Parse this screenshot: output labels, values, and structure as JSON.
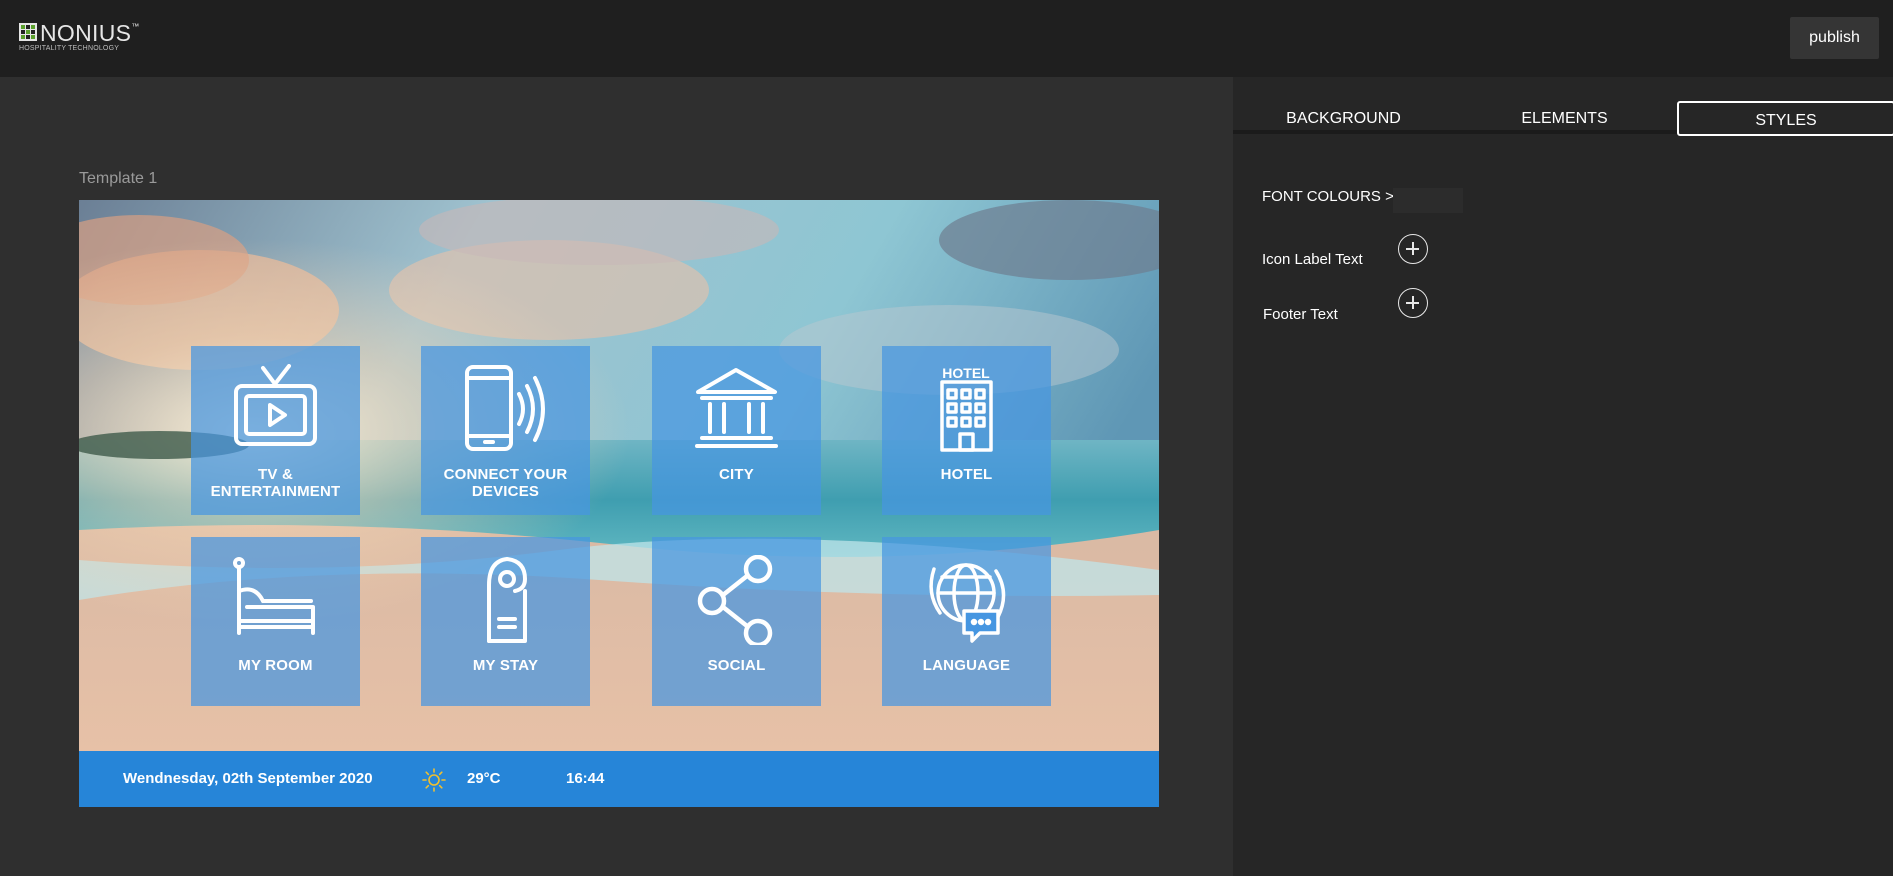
{
  "app": {
    "logo_brand": "NONIUS",
    "logo_tm": "™",
    "logo_tagline": "HOSPITALITY TECHNOLOGY",
    "publish_label": "publish"
  },
  "panel": {
    "tabs": [
      {
        "label": "BACKGROUND"
      },
      {
        "label": "ELEMENTS"
      },
      {
        "label": "STYLES",
        "active": true
      }
    ],
    "section_title": "FONT COLOURS >",
    "rows": [
      {
        "label": "Icon Label Text"
      },
      {
        "label": "Footer Text"
      }
    ]
  },
  "canvas": {
    "template_label": "Template 1",
    "tiles": [
      {
        "icon": "tv-icon",
        "label_line1": "TV &",
        "label_line2": "ENTERTAINMENT"
      },
      {
        "icon": "smartphone-icon",
        "label_line1": "CONNECT YOUR",
        "label_line2": "DEVICES"
      },
      {
        "icon": "museum-icon",
        "label_line1": "CITY",
        "label_line2": ""
      },
      {
        "icon": "hotel-building-icon",
        "label_line1": "HOTEL",
        "label_line2": ""
      },
      {
        "icon": "bed-icon",
        "label_line1": "MY ROOM",
        "label_line2": ""
      },
      {
        "icon": "door-hanger-icon",
        "label_line1": "MY STAY",
        "label_line2": ""
      },
      {
        "icon": "share-icon",
        "label_line1": "SOCIAL",
        "label_line2": ""
      },
      {
        "icon": "globe-language-icon",
        "label_line1": "LANGUAGE",
        "label_line2": ""
      }
    ],
    "footer": {
      "date": "Wendnesday, 02th September 2020",
      "weather_icon": "sun-icon",
      "temperature": "29°C",
      "time": "16:44"
    }
  },
  "colors": {
    "topbar": "#1f1f1f",
    "workspace": "#2f2f2f",
    "panel": "#262626",
    "tile": "#4696e1",
    "footer": "#2685d8"
  }
}
